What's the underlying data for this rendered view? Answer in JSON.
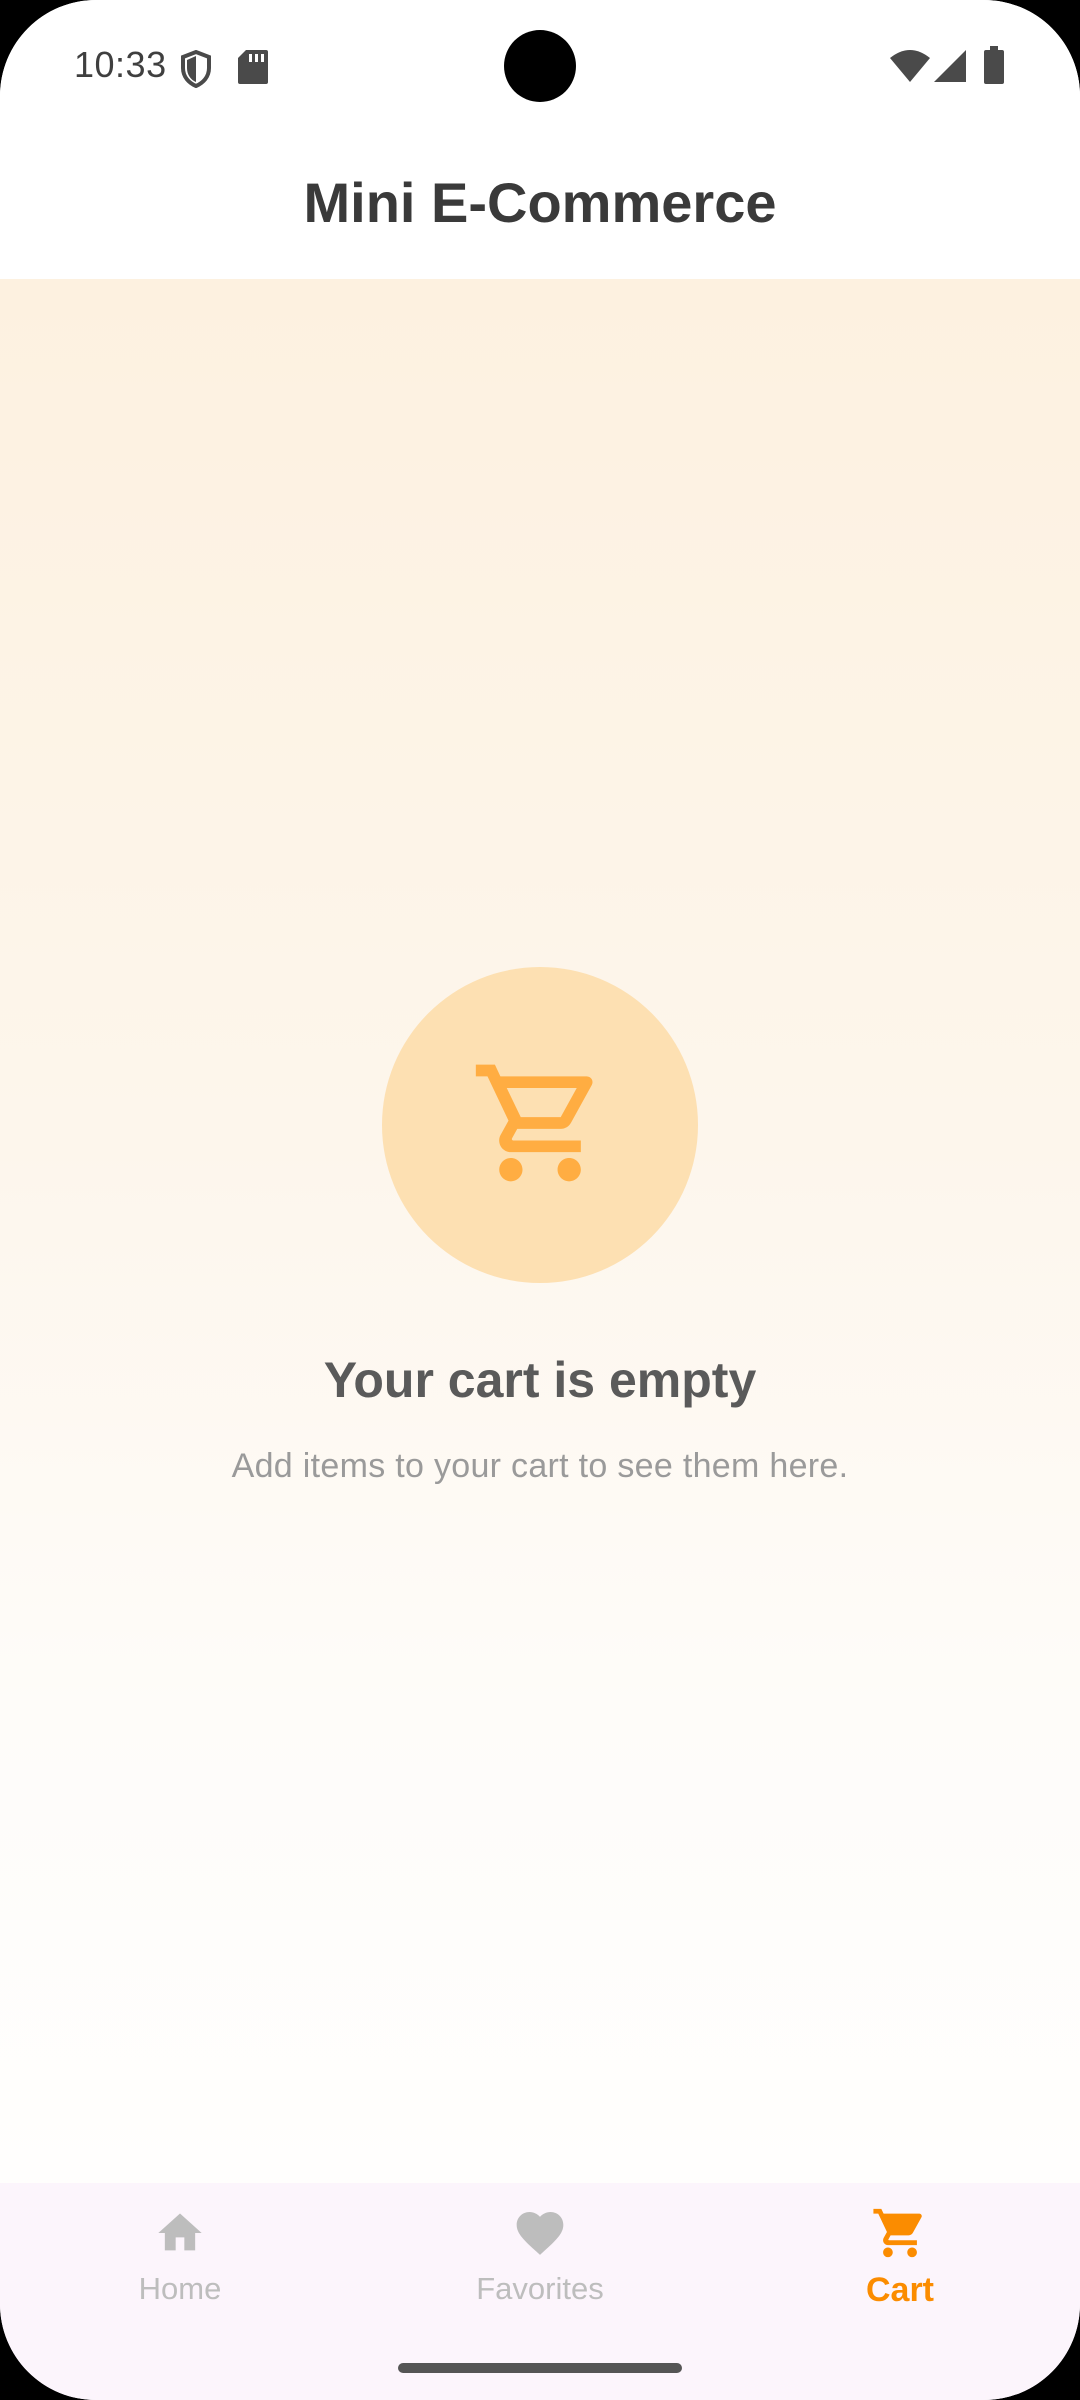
{
  "status_bar": {
    "time": "10:33",
    "icons": [
      "shield-icon",
      "sd-card-icon",
      "wifi-icon",
      "signal-icon",
      "battery-icon"
    ]
  },
  "app_bar": {
    "title": "Mini E-Commerce"
  },
  "empty_state": {
    "icon": "shopping-cart-icon",
    "title": "Your cart is empty",
    "subtitle": "Add items to your cart to see them here."
  },
  "bottom_nav": {
    "items": [
      {
        "label": "Home",
        "icon": "home-icon",
        "active": false
      },
      {
        "label": "Favorites",
        "icon": "heart-icon",
        "active": false
      },
      {
        "label": "Cart",
        "icon": "shopping-cart-icon",
        "active": true
      }
    ]
  },
  "colors": {
    "accent": "#fb8c00",
    "cart_icon": "#ffad42",
    "cart_circle": "#fde0b2",
    "inactive_nav": "#bdbdbd",
    "nav_background": "#fcf5fc",
    "title_text": "#3a3a3a"
  }
}
